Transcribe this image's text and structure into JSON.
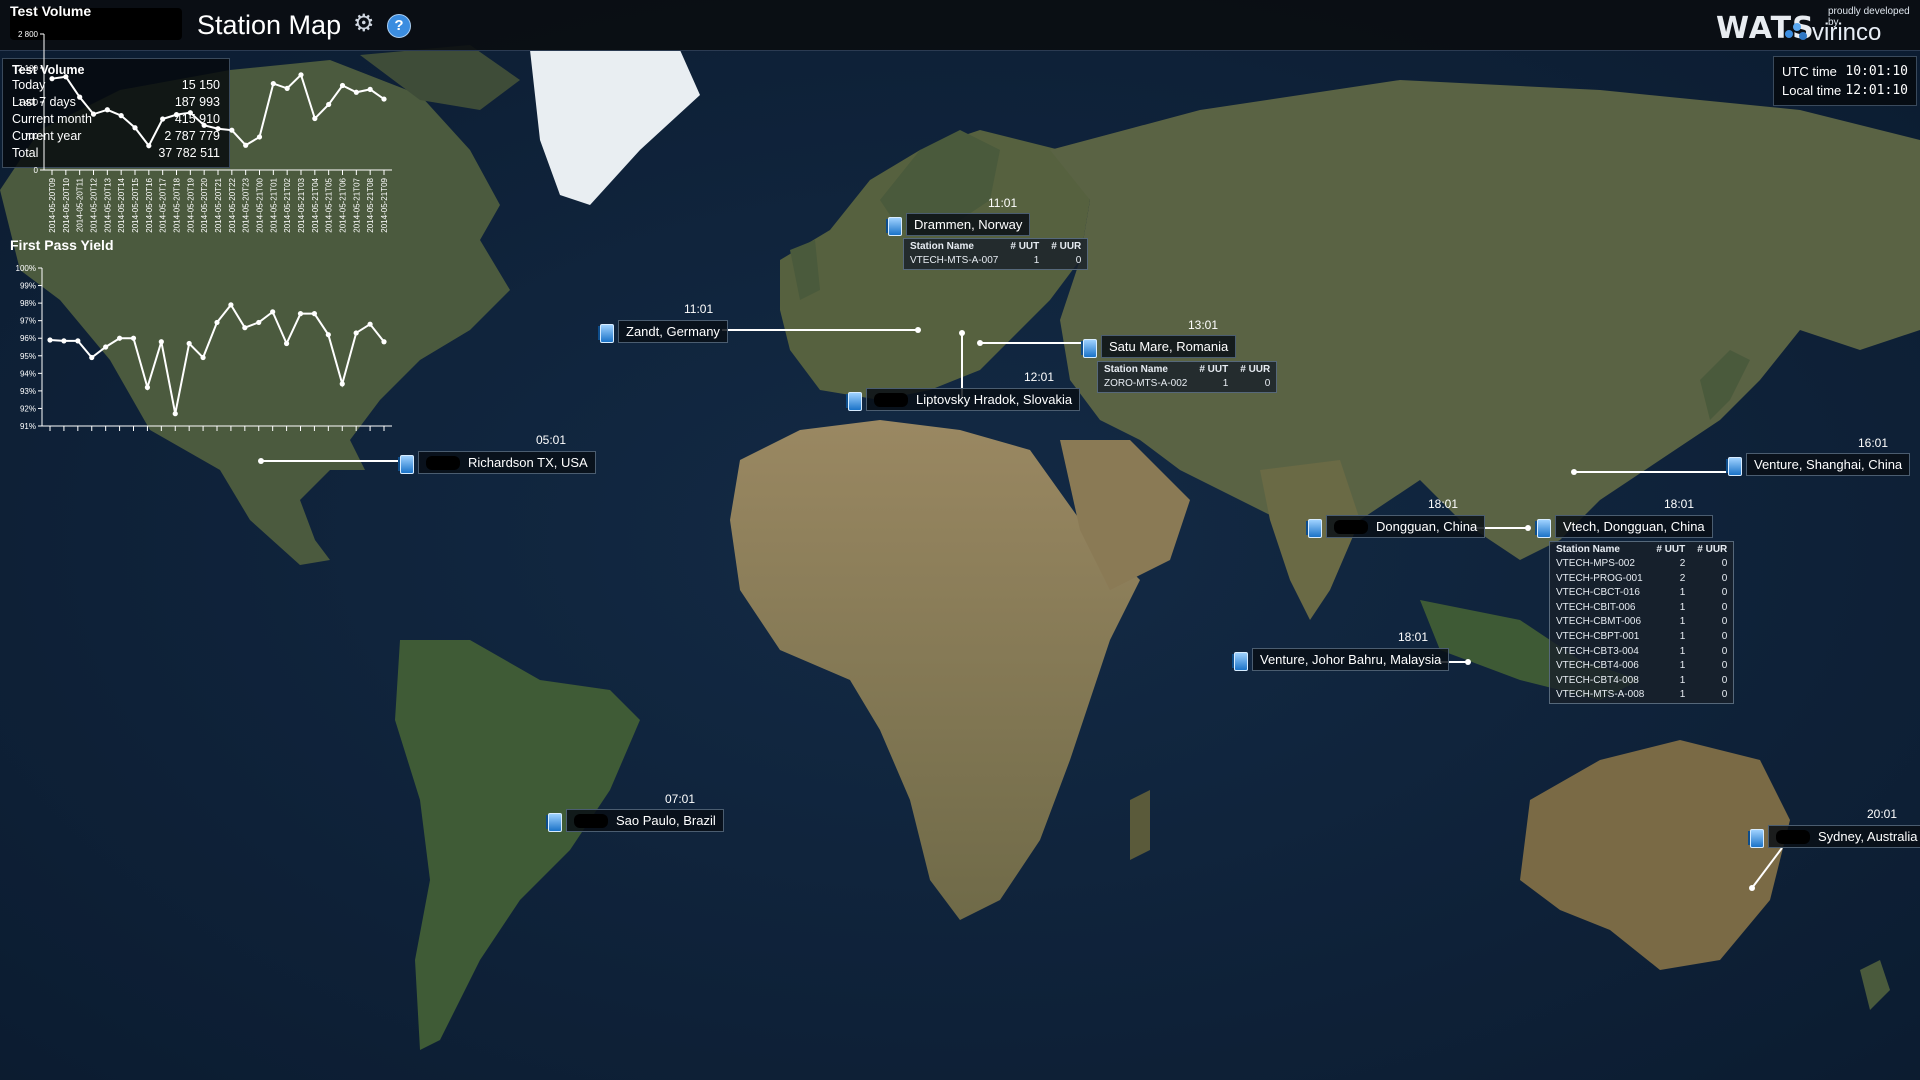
{
  "header": {
    "title": "Station Map",
    "brand": "WATS",
    "developer_note": "proudly developed by",
    "developer": "virinco"
  },
  "test_volume_summary": {
    "title": "Test Volume",
    "rows": [
      {
        "label": "Today",
        "value": "15 150"
      },
      {
        "label": "Last 7 days",
        "value": "187 993"
      },
      {
        "label": "Current month",
        "value": "415 910"
      },
      {
        "label": "Current year",
        "value": "2 787 779"
      },
      {
        "label": "Total",
        "value": "37 782 511"
      }
    ]
  },
  "clock": {
    "utc_label": "UTC time",
    "utc_value": "10:01:10",
    "local_label": "Local time",
    "local_value": "12:01:10"
  },
  "stations": [
    {
      "name": "Drammen, Norway",
      "time": "11:01"
    },
    {
      "name": "Zandt, Germany",
      "time": "11:01"
    },
    {
      "name": "Satu Mare, Romania",
      "time": "13:01"
    },
    {
      "name": "Liptovsky Hradok, Slovakia",
      "time": "12:01"
    },
    {
      "name": "Richardson TX, USA",
      "time": "05:01"
    },
    {
      "name": "Venture, Shanghai, China",
      "time": "16:01"
    },
    {
      "name": "Dongguan, China",
      "time": "18:01"
    },
    {
      "name": "Vtech, Dongguan, China",
      "time": "18:01"
    },
    {
      "name": "Venture, Johor Bahru, Malaysia",
      "time": "18:01"
    },
    {
      "name": "Sao Paulo, Brazil",
      "time": "07:01"
    },
    {
      "name": "Sydney, Australia",
      "time": "20:01"
    }
  ],
  "station_tables": {
    "headers": {
      "name": "Station Name",
      "uut": "# UUT",
      "uur": "# UUR"
    },
    "drammen": [
      {
        "name": "VTECH-MTS-A-007",
        "uut": "1",
        "uur": "0"
      }
    ],
    "satu_mare": [
      {
        "name": "ZORO-MTS-A-002",
        "uut": "1",
        "uur": "0"
      }
    ],
    "vtech_dongguan": [
      {
        "name": "VTECH-MPS-002",
        "uut": "2",
        "uur": "0"
      },
      {
        "name": "VTECH-PROG-001",
        "uut": "2",
        "uur": "0"
      },
      {
        "name": "VTECH-CBCT-016",
        "uut": "1",
        "uur": "0"
      },
      {
        "name": "VTECH-CBIT-006",
        "uut": "1",
        "uur": "0"
      },
      {
        "name": "VTECH-CBMT-006",
        "uut": "1",
        "uur": "0"
      },
      {
        "name": "VTECH-CBPT-001",
        "uut": "1",
        "uur": "0"
      },
      {
        "name": "VTECH-CBT3-004",
        "uut": "1",
        "uur": "0"
      },
      {
        "name": "VTECH-CBT4-006",
        "uut": "1",
        "uur": "0"
      },
      {
        "name": "VTECH-CBT4-008",
        "uut": "1",
        "uur": "0"
      },
      {
        "name": "VTECH-MTS-A-008",
        "uut": "1",
        "uur": "0"
      }
    ]
  },
  "chart_data": [
    {
      "type": "line",
      "title": "Test Volume",
      "yticks": [
        "2 800",
        "2 100",
        "1 400",
        "700",
        "0"
      ],
      "ylim": [
        0,
        2800
      ],
      "x": [
        "2014-05-20T09",
        "2014-05-20T10",
        "2014-05-20T11",
        "2014-05-20T12",
        "2014-05-20T13",
        "2014-05-20T14",
        "2014-05-20T15",
        "2014-05-20T16",
        "2014-05-20T17",
        "2014-05-20T18",
        "2014-05-20T19",
        "2014-05-20T20",
        "2014-05-20T21",
        "2014-05-20T22",
        "2014-05-20T23",
        "2014-05-21T00",
        "2014-05-21T01",
        "2014-05-21T02",
        "2014-05-21T03",
        "2014-05-21T04",
        "2014-05-21T05",
        "2014-05-21T06",
        "2014-05-21T07",
        "2014-05-21T08",
        "2014-05-21T09"
      ],
      "values": [
        1880,
        1920,
        1500,
        1150,
        1240,
        1120,
        870,
        500,
        1050,
        1140,
        1180,
        920,
        850,
        820,
        510,
        680,
        1780,
        1680,
        1960,
        1060,
        1350,
        1740,
        1600,
        1660,
        1460
      ],
      "grid": false
    },
    {
      "type": "line",
      "title": "First Pass Yield",
      "yticks": [
        "100%",
        "99%",
        "98%",
        "97%",
        "96%",
        "95%",
        "94%",
        "93%",
        "92%",
        "91%"
      ],
      "ylim": [
        91,
        100
      ],
      "values": [
        95.9,
        95.85,
        95.85,
        94.9,
        95.5,
        96.0,
        96.0,
        93.2,
        95.8,
        91.7,
        95.7,
        94.9,
        96.9,
        97.9,
        96.6,
        96.9,
        97.5,
        95.7,
        97.4,
        97.4,
        96.2,
        93.4,
        96.3,
        96.8,
        95.8
      ],
      "grid": false
    }
  ]
}
